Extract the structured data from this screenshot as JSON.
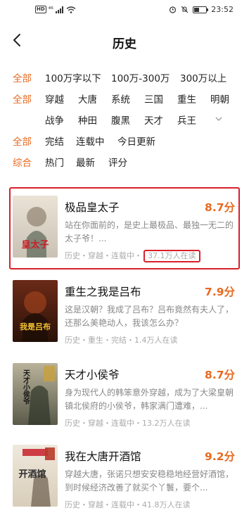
{
  "status_bar": {
    "hd": "HD",
    "network": "⁴⁶",
    "time": "23:52",
    "battery_level": 0.4
  },
  "header": {
    "title": "历史"
  },
  "filters": {
    "row1": {
      "category": "全部",
      "options": [
        "100万字以下",
        "100万-300万",
        "300万以上"
      ]
    },
    "row2": {
      "category": "全部",
      "options": [
        "穿越",
        "大唐",
        "系统",
        "三国",
        "重生",
        "明朝"
      ]
    },
    "row3": {
      "options": [
        "战争",
        "种田",
        "腹黑",
        "天才",
        "兵王"
      ]
    },
    "row4": {
      "category": "全部",
      "options": [
        "完结",
        "连载中",
        "今日更新"
      ]
    },
    "row5": {
      "category": "综合",
      "options": [
        "热门",
        "最新",
        "评分"
      ]
    }
  },
  "books": [
    {
      "title": "极品皇太子",
      "score": "8.7分",
      "desc": "站在你面前的，是史上最极品、最独一无二的太子爷！...",
      "meta": "历史・穿越・连载中・",
      "readers": "37.1万人在读",
      "cover_text": "皇太子",
      "cover_colors": [
        "#eae3d6",
        "#c9c2b4"
      ],
      "cover_accent": "#c8202a"
    },
    {
      "title": "重生之我是吕布",
      "score": "7.9分",
      "desc": "这是汉朝？我成了吕布？吕布竟然有夫人了，还那么美艳动人，我该怎么办？",
      "meta": "历史・重生・完结・",
      "readers": "1.4万人在读",
      "cover_text": "我是吕布",
      "cover_colors": [
        "#6b2a17",
        "#2a1208"
      ],
      "cover_accent": "#f2c230"
    },
    {
      "title": "天才小侯爷",
      "score": "8.7分",
      "desc": "身为现代人的韩笨意外穿越，成为了大梁皇朝镇北侯府的小侯爷，韩家满门遭难，...",
      "meta": "历史・穿越・连载中・",
      "readers": "13.2万人在读",
      "cover_text": "天才小侯爷",
      "cover_colors": [
        "#b9b39a",
        "#5b5a4a"
      ],
      "cover_accent": "#1a1a1a"
    },
    {
      "title": "我在大唐开酒馆",
      "score": "9.2分",
      "desc": "穿越大唐，张诺只想安安稳稳地经营好酒馆，到时候经济改善了就买个丫鬟，要个...",
      "meta": "历史・穿越・连载中・",
      "readers": "41.8万人在读",
      "cover_text": "开酒馆",
      "cover_colors": [
        "#efe8dc",
        "#d8cdb9"
      ],
      "cover_accent": "#2b2b2b"
    }
  ]
}
